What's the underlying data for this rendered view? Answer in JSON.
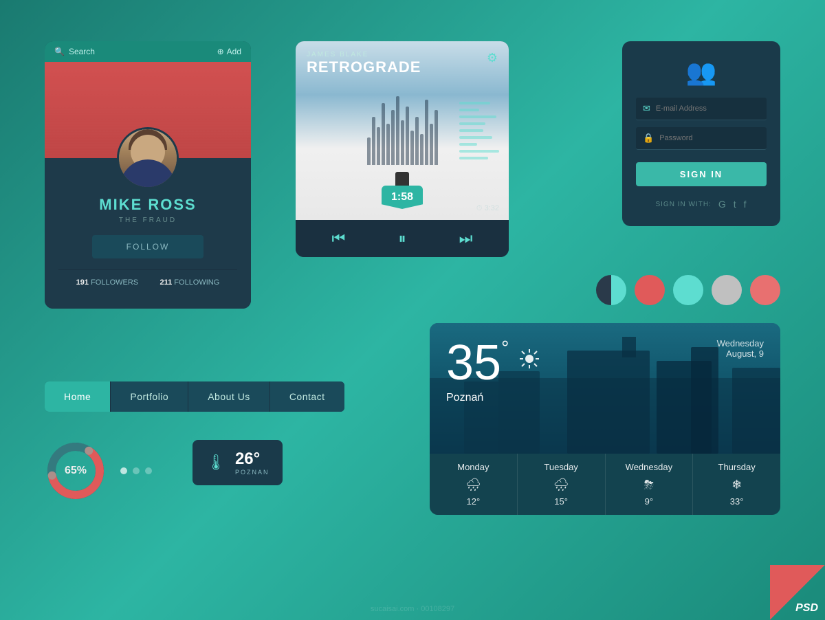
{
  "background": "#2a9d8f",
  "profile_card": {
    "search_label": "Search",
    "add_label": "Add",
    "name": "MIKE ROSS",
    "subtitle": "THE FRAUD",
    "follow_label": "FOLLOW",
    "followers_count": "191",
    "followers_label": "FOLLOWERS",
    "following_count": "211",
    "following_label": "FOLLOWING"
  },
  "music_player": {
    "artist": "JAMES BLAKE",
    "title": "RETROGRADE",
    "current_time": "1:58",
    "total_time": "3:32"
  },
  "login": {
    "email_placeholder": "E-mail Address",
    "password_placeholder": "Password",
    "sign_in_label": "SIGN IN",
    "sign_in_with_label": "SIGN IN WITH:"
  },
  "nav": {
    "items": [
      {
        "label": "Home",
        "active": true
      },
      {
        "label": "Portfolio",
        "active": false
      },
      {
        "label": "About Us",
        "active": false
      },
      {
        "label": "Contact",
        "active": false
      }
    ]
  },
  "donut": {
    "percent": "65%",
    "value": 65
  },
  "temp_widget": {
    "value": "26°",
    "city": "POZNAN"
  },
  "weather": {
    "temperature": "35",
    "unit": "°",
    "city": "Poznań",
    "day": "Wednesday",
    "month_day": "August, 9",
    "forecast": [
      {
        "day": "Monday",
        "icon": "🌧",
        "temp": "12°"
      },
      {
        "day": "Tuesday",
        "icon": "🌧",
        "temp": "15°"
      },
      {
        "day": "Wednesday",
        "icon": "🌩",
        "temp": "9°"
      },
      {
        "day": "Thursday",
        "icon": "❄",
        "temp": "33°"
      }
    ]
  },
  "colors": {
    "dark_teal": "#2a3a4a",
    "teal": "#5dddd0",
    "coral": "#e05a5a",
    "light_teal": "#2db5a3",
    "salmon": "#e87070"
  },
  "psd_label": "PSD",
  "watermark": "sucaisai.com · 00108297"
}
